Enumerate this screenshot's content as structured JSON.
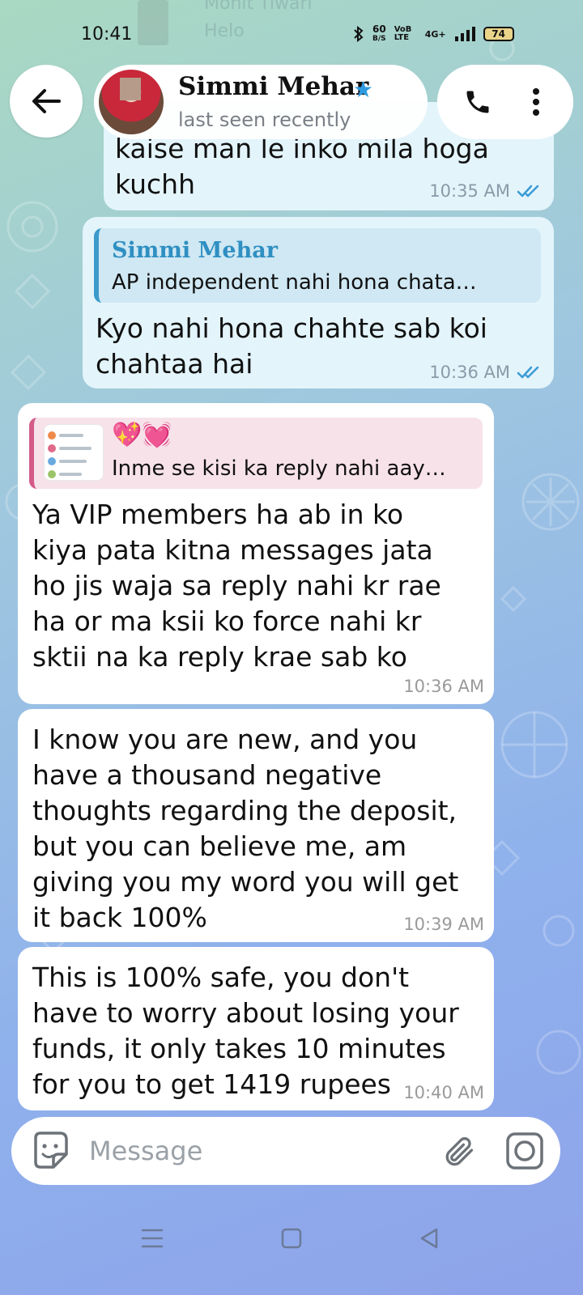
{
  "status_bar": {
    "time": "10:41",
    "network_speed": "60",
    "network_unit": "B/S",
    "volte": "VoB LTE",
    "signal_label": "4G+",
    "battery": "74",
    "ghost_name": "Mohit Tiwari",
    "ghost_preview": "Helo"
  },
  "header": {
    "contact_name": "Simmi Mehar",
    "status": "last seen recently",
    "back_icon": "arrow-left-icon",
    "call_icon": "phone-icon",
    "menu_icon": "more-vertical-icon",
    "badge_icon": "star-icon",
    "badge_color": "#2f9be0"
  },
  "messages": [
    {
      "direction": "outgoing",
      "text_lines": [
        "kaise man le inko mila hoga",
        "kuchh"
      ],
      "time": "10:35 AM",
      "read": true
    },
    {
      "direction": "outgoing",
      "reply_to": {
        "name": "Simmi Mehar",
        "text": "AP independent nahi hona chata…"
      },
      "text_lines": [
        "Kyo nahi hona chahte sab koi",
        "chahtaa hai"
      ],
      "time": "10:36 AM",
      "read": true
    },
    {
      "direction": "incoming",
      "reply_to": {
        "emoji": "💖💓",
        "text": "Inme se kisi ka reply nahi aay…"
      },
      "text_lines": [
        "Ya VIP members ha ab in ko",
        "kiya pata kitna messages jata",
        "ho jis waja sa reply nahi kr rae",
        "ha or ma ksii ko force nahi kr",
        "sktii na ka reply krae sab ko"
      ],
      "time": "10:36 AM"
    },
    {
      "direction": "incoming",
      "text_lines": [
        "I know you are new, and you",
        "have a thousand negative",
        "thoughts regarding the deposit,",
        "but you can believe me, am",
        "giving you my word you will get",
        "it back 100%"
      ],
      "time": "10:39 AM"
    },
    {
      "direction": "incoming",
      "text_lines": [
        "This is 100% safe, you don't",
        "have to worry about losing your",
        "funds, it only takes 10 minutes",
        "for you to get 1419 rupees"
      ],
      "time": "10:40 AM"
    }
  ],
  "composer": {
    "placeholder": "Message",
    "emoji_icon": "sticker-smile-icon",
    "attach_icon": "paperclip-icon",
    "camera_icon": "camera-icon"
  },
  "navbar": {
    "menu_icon": "recent-apps-icon",
    "home_icon": "home-icon",
    "back_icon": "back-triangle-icon"
  },
  "colors": {
    "outgoing_bubble": "#e3f4fb",
    "incoming_bubble": "#ffffff",
    "read_tick": "#3a9bd6",
    "reply_accent_out": "#3c9acb",
    "reply_accent_in": "#d45a87"
  }
}
